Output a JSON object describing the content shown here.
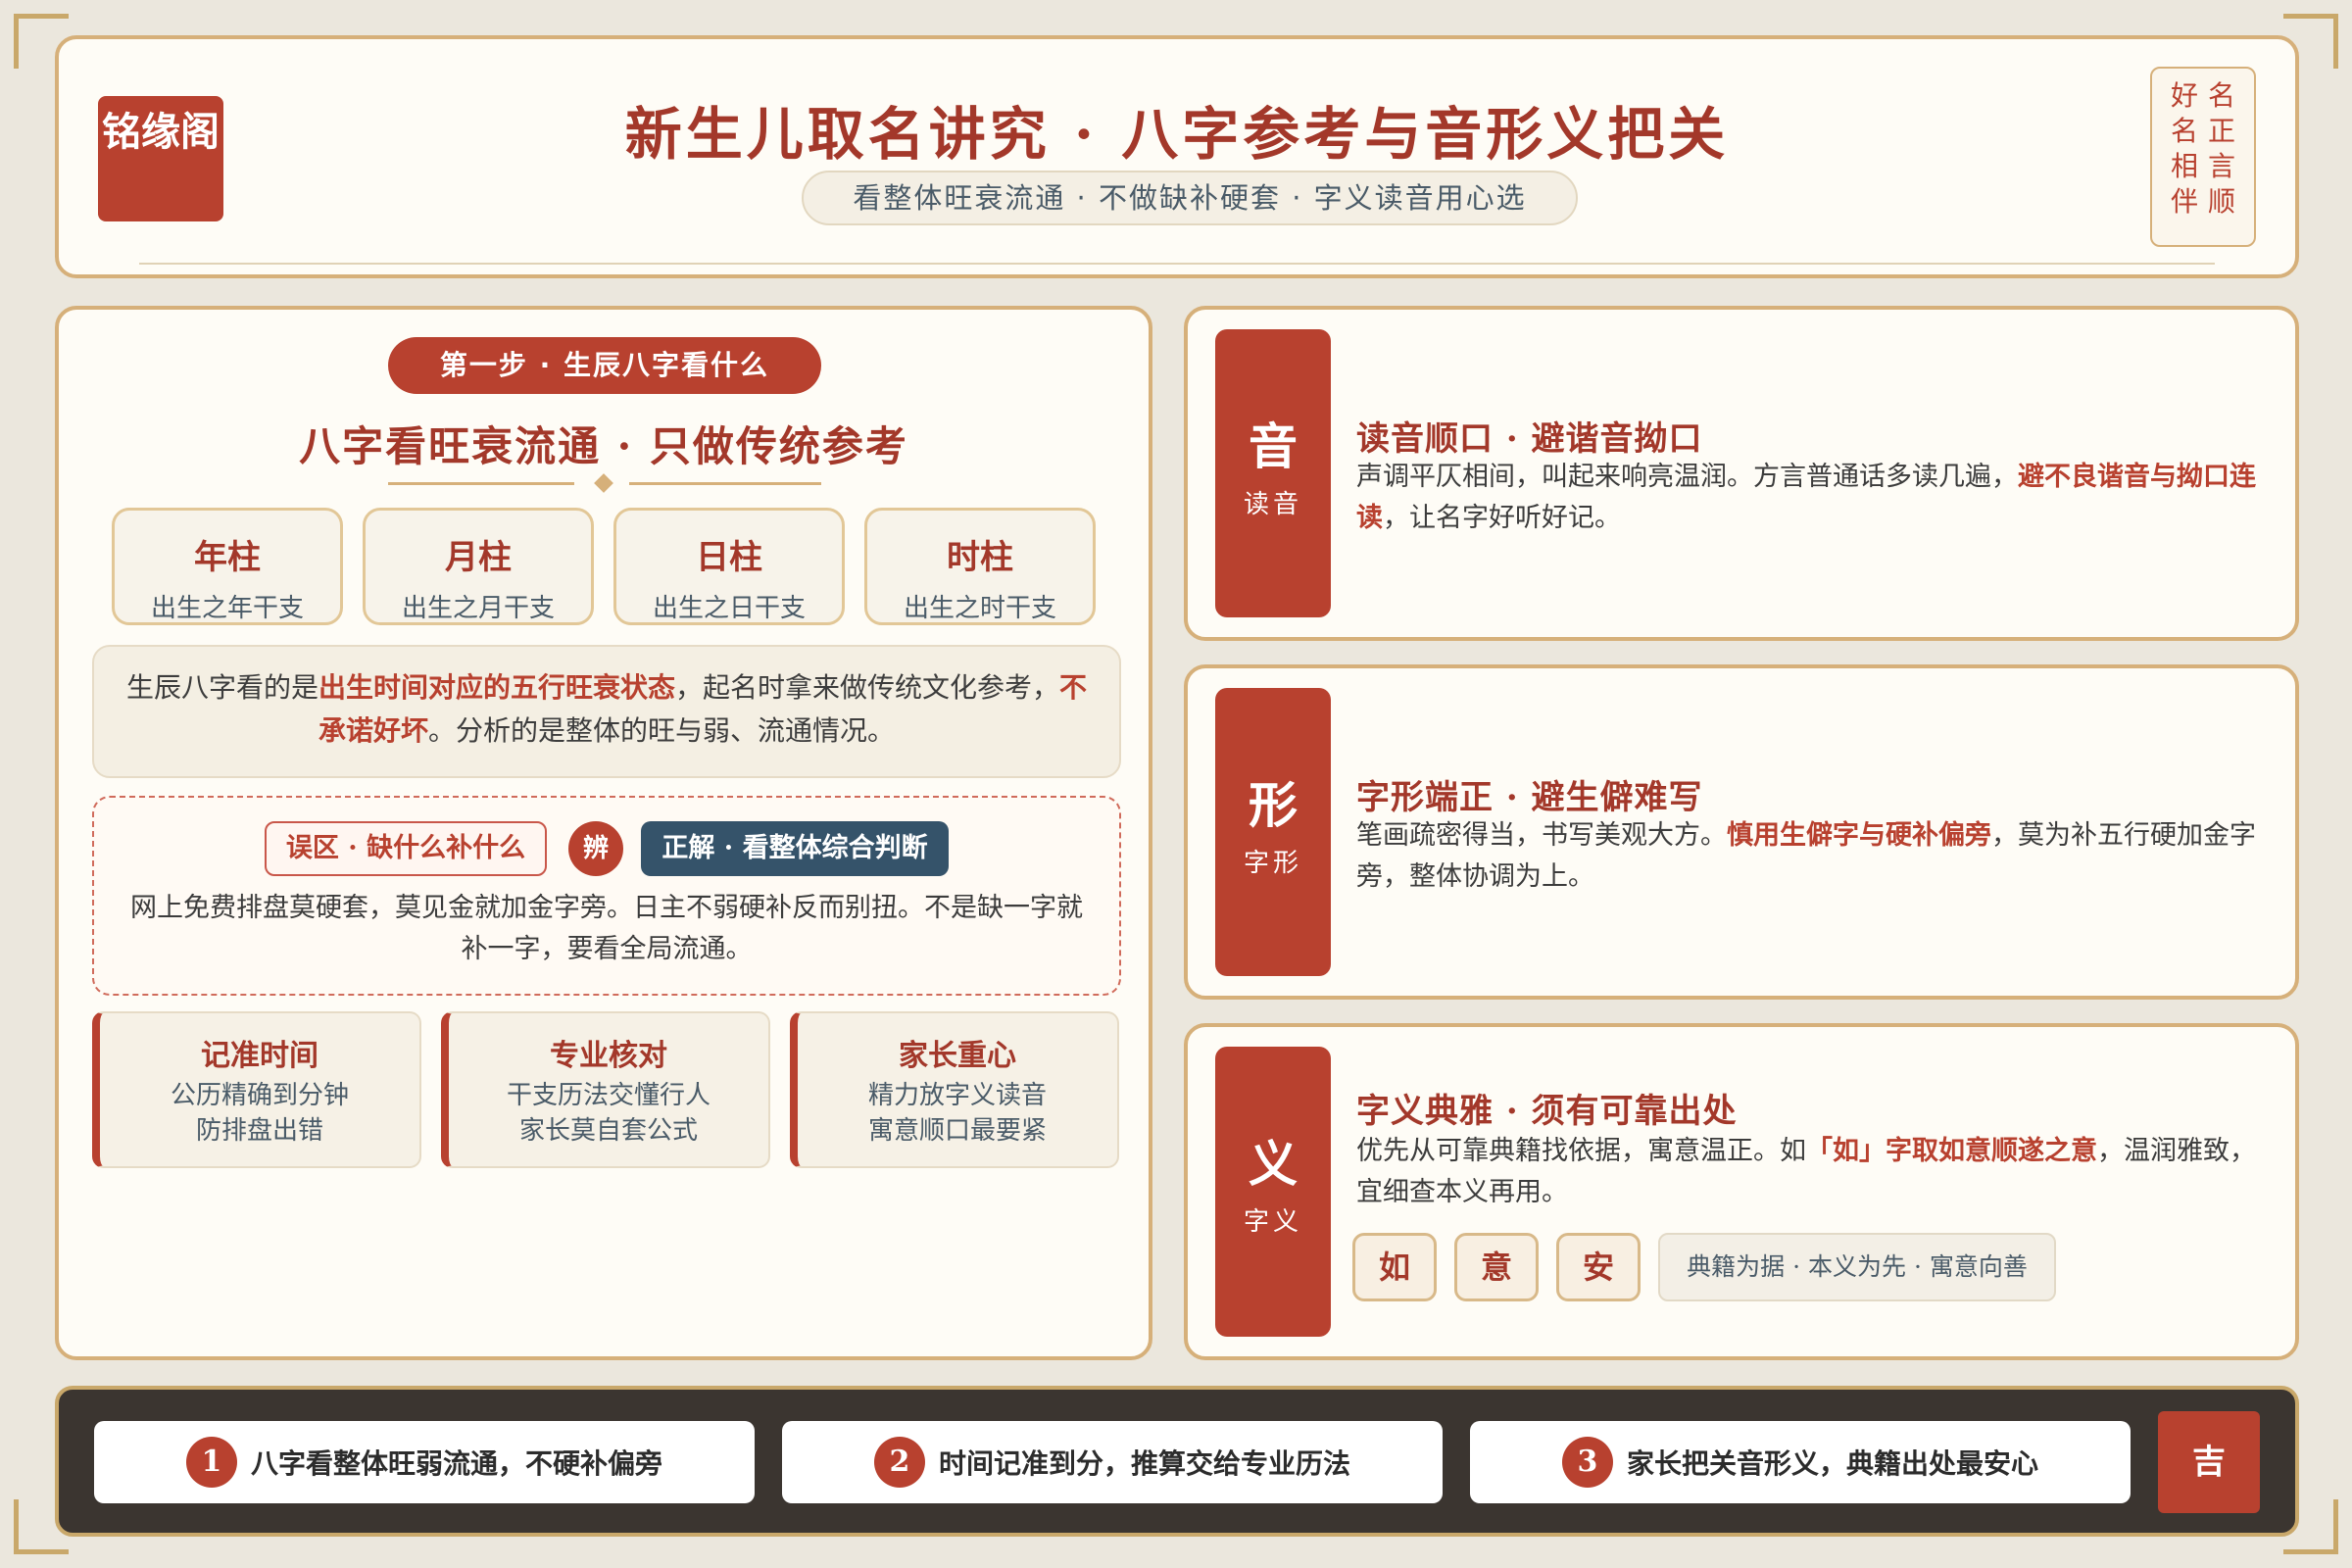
{
  "header": {
    "logo": "铭缘阁",
    "title": "新生儿取名讲究 · 八字参考与音形义把关",
    "subtitle": "看整体旺衰流通 · 不做缺补硬套 · 字义读音用心选",
    "seal_right": "名正言顺",
    "seal_left": "好名相伴"
  },
  "left": {
    "step": "第一步 · 生辰八字看什么",
    "title": "八字看旺衰流通 · 只做传统参考",
    "pillars": [
      {
        "name": "年柱",
        "sub": "出生之年干支"
      },
      {
        "name": "月柱",
        "sub": "出生之月干支"
      },
      {
        "name": "日柱",
        "sub": "出生之日干支"
      },
      {
        "name": "时柱",
        "sub": "出生之时干支"
      }
    ],
    "info": {
      "p1": "生辰八字看的是",
      "h1": "出生时间对应的五行旺衰状态",
      "p2": "，起名时拿来做传统文化参考，",
      "h2": "不承诺好坏",
      "p3": "。分析的是整体的旺与弱、流通情况。"
    },
    "myth": {
      "wrong": "误区 · 缺什么补什么",
      "vs": "辨",
      "right": "正解 · 看整体综合判断",
      "text": "网上免费排盘莫硬套，莫见金就加金字旁。日主不弱硬补反而别扭。不是缺一字就补一字，要看全局流通。"
    },
    "tips": [
      {
        "title": "记准时间",
        "l1": "公历精确到分钟",
        "l2": "防排盘出错"
      },
      {
        "title": "专业核对",
        "l1": "干支历法交懂行人",
        "l2": "家长莫自套公式"
      },
      {
        "title": "家长重心",
        "l1": "精力放字义读音",
        "l2": "寓意顺口最要紧"
      }
    ]
  },
  "right": {
    "sound": {
      "big": "音",
      "small": "读音",
      "title": "读音顺口 · 避谐音拗口",
      "t1": "声调平仄相间，叫起来响亮温润。方言普通话多读几遍，",
      "h1": "避不良谐音与拗口连读",
      "t2": "，让名字好听好记。"
    },
    "form": {
      "big": "形",
      "small": "字形",
      "title": "字形端正 · 避生僻难写",
      "t1": "笔画疏密得当，书写美观大方。",
      "h1": "慎用生僻字与硬补偏旁",
      "t2": "，莫为补五行硬加金字旁，整体协调为上。"
    },
    "meaning": {
      "big": "义",
      "small": "字义",
      "title": "字义典雅 · 须有可靠出处",
      "t1": "优先从可靠典籍找依据，寓意温正。如",
      "h1": "「如」字取如意顺遂之意",
      "t2": "，温润雅致，宜细查本义再用。",
      "chars": [
        "如",
        "意",
        "安"
      ],
      "note": "典籍为据 · 本义为先 · 寓意向善"
    }
  },
  "footer": {
    "items": [
      {
        "num": "1",
        "text": "八字看整体旺弱流通，不硬补偏旁"
      },
      {
        "num": "2",
        "text": "时间记准到分，推算交给专业历法"
      },
      {
        "num": "3",
        "text": "家长把关音形义，典籍出处最安心"
      }
    ],
    "badge": "吉"
  },
  "colors": {
    "accent": "#b8412f",
    "gold": "#d6b07a",
    "navy": "#35536a",
    "footer_bg": "#3b3530"
  }
}
